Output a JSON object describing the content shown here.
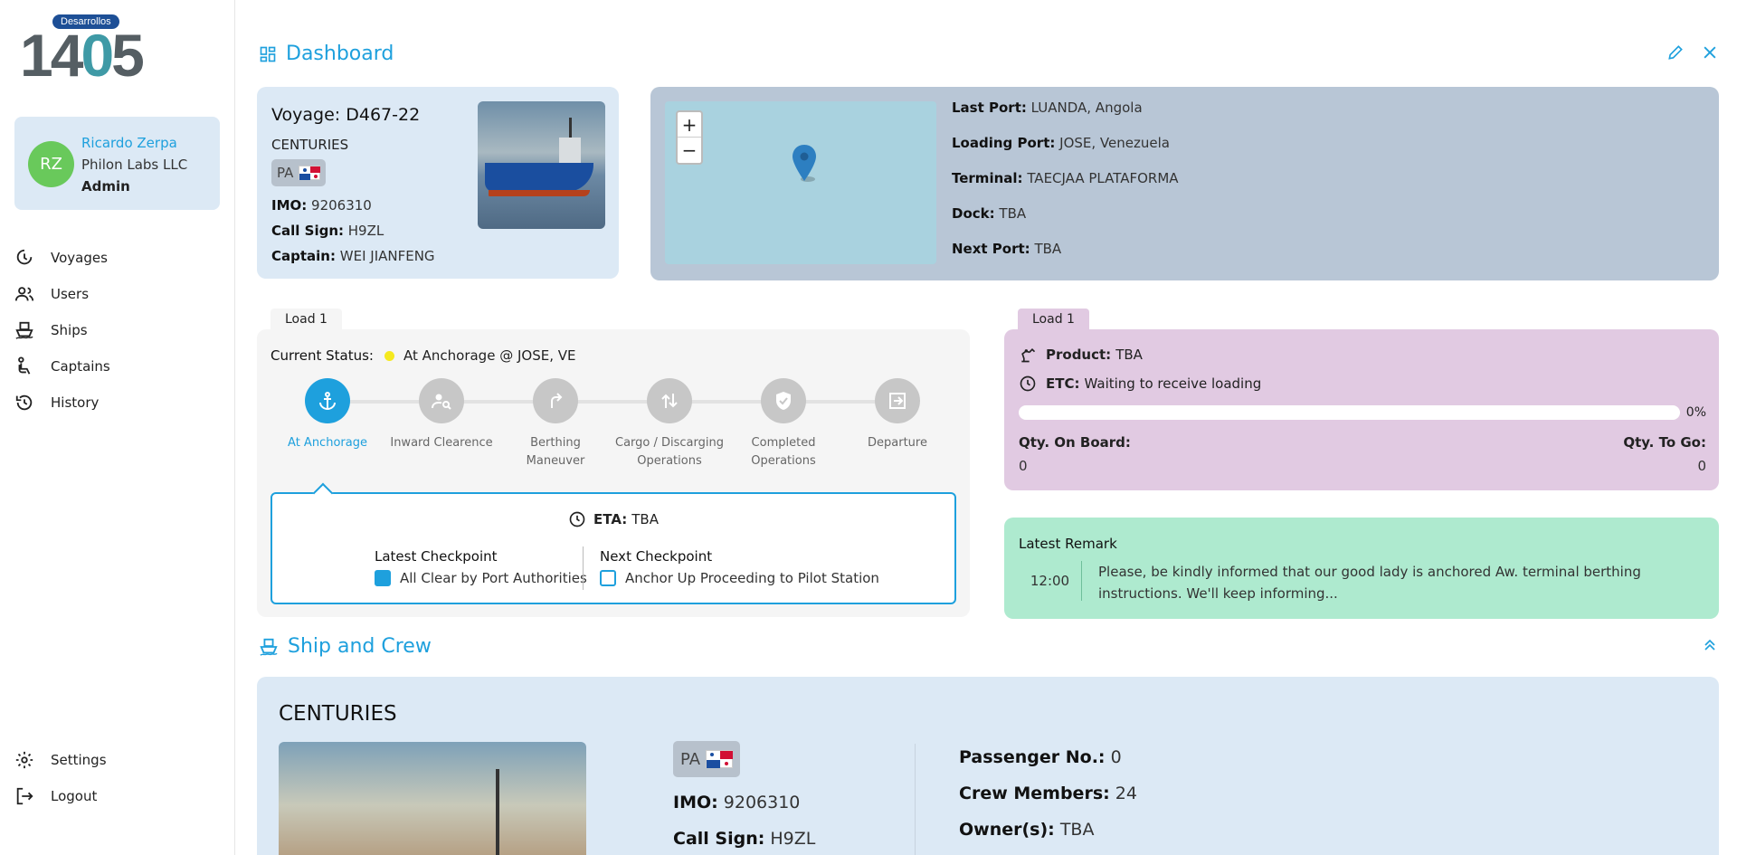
{
  "logo": {
    "badge": "Desarrollos",
    "digits": [
      "1",
      "4",
      "0",
      "5"
    ]
  },
  "user": {
    "initials": "RZ",
    "name": "Ricardo Zerpa",
    "company": "Philon Labs LLC",
    "role": "Admin"
  },
  "nav": {
    "items": [
      {
        "label": "Voyages",
        "icon": "voyage-icon"
      },
      {
        "label": "Users",
        "icon": "users-icon"
      },
      {
        "label": "Ships",
        "icon": "ship-icon"
      },
      {
        "label": "Captains",
        "icon": "captain-icon"
      },
      {
        "label": "History",
        "icon": "history-icon"
      }
    ],
    "bottom": [
      {
        "label": "Settings",
        "icon": "gear-icon"
      },
      {
        "label": "Logout",
        "icon": "logout-icon"
      }
    ]
  },
  "dashboard": {
    "title": "Dashboard"
  },
  "voyage": {
    "title": "Voyage: D467-22",
    "ship": "CENTURIES",
    "flag_code": "PA",
    "imo_label": "IMO:",
    "imo": "9206310",
    "callsign_label": "Call Sign:",
    "callsign": "H9ZL",
    "captain_label": "Captain:",
    "captain": "WEI JIANFENG"
  },
  "map": {
    "zoom_in": "+",
    "zoom_out": "−",
    "last_port_label": "Last Port:",
    "last_port": "LUANDA, Angola",
    "loading_port_label": "Loading Port:",
    "loading_port": "JOSE, Venezuela",
    "terminal_label": "Terminal:",
    "terminal": "TAECJAA PLATAFORMA",
    "dock_label": "Dock:",
    "dock": "TBA",
    "next_port_label": "Next Port:",
    "next_port": "TBA"
  },
  "load_left": {
    "tab": "Load 1",
    "status_label": "Current Status:",
    "status": "At Anchorage @ JOSE, VE",
    "status_color": "#f5e91f",
    "steps": [
      {
        "line1": "At Anchorage",
        "line2": ""
      },
      {
        "line1": "Inward Clearence",
        "line2": ""
      },
      {
        "line1": "Berthing",
        "line2": "Maneuver"
      },
      {
        "line1": "Cargo / Discarging",
        "line2": "Operations"
      },
      {
        "line1": "Completed",
        "line2": "Operations"
      },
      {
        "line1": "Departure",
        "line2": ""
      }
    ],
    "eta_label": "ETA:",
    "eta": "TBA",
    "latest_checkpoint_label": "Latest Checkpoint",
    "latest_checkpoint": "All Clear by Port Authorities",
    "next_checkpoint_label": "Next Checkpoint",
    "next_checkpoint": "Anchor Up Proceeding to Pilot Station"
  },
  "load_right": {
    "tab": "Load 1",
    "product_label": "Product:",
    "product": "TBA",
    "etc_label": "ETC:",
    "etc": "Waiting to receive loading",
    "progress_percent": 0,
    "progress_text": "0%",
    "qty_on_board_label": "Qty. On Board:",
    "qty_on_board": "0",
    "qty_to_go_label": "Qty. To Go:",
    "qty_to_go": "0"
  },
  "remark": {
    "title": "Latest Remark",
    "time": "12:00",
    "text": "Please, be kindly informed that our good lady is anchored Aw. terminal berthing instructions. We'll keep informing..."
  },
  "crew": {
    "title": "Ship and Crew",
    "ship": "CENTURIES",
    "flag_code": "PA",
    "imo_label": "IMO:",
    "imo": "9206310",
    "callsign_label": "Call Sign:",
    "callsign": "H9ZL",
    "passenger_label": "Passenger No.:",
    "passenger": "0",
    "crew_label": "Crew Members:",
    "crew_members": "24",
    "owner_label": "Owner(s):",
    "owner": "TBA"
  },
  "colors": {
    "accent": "#1ea0dd",
    "user_card": "#dce9f5",
    "map_card": "#b8c6d6",
    "product_card": "#e1cae2",
    "remark_card": "#aeeacf"
  }
}
